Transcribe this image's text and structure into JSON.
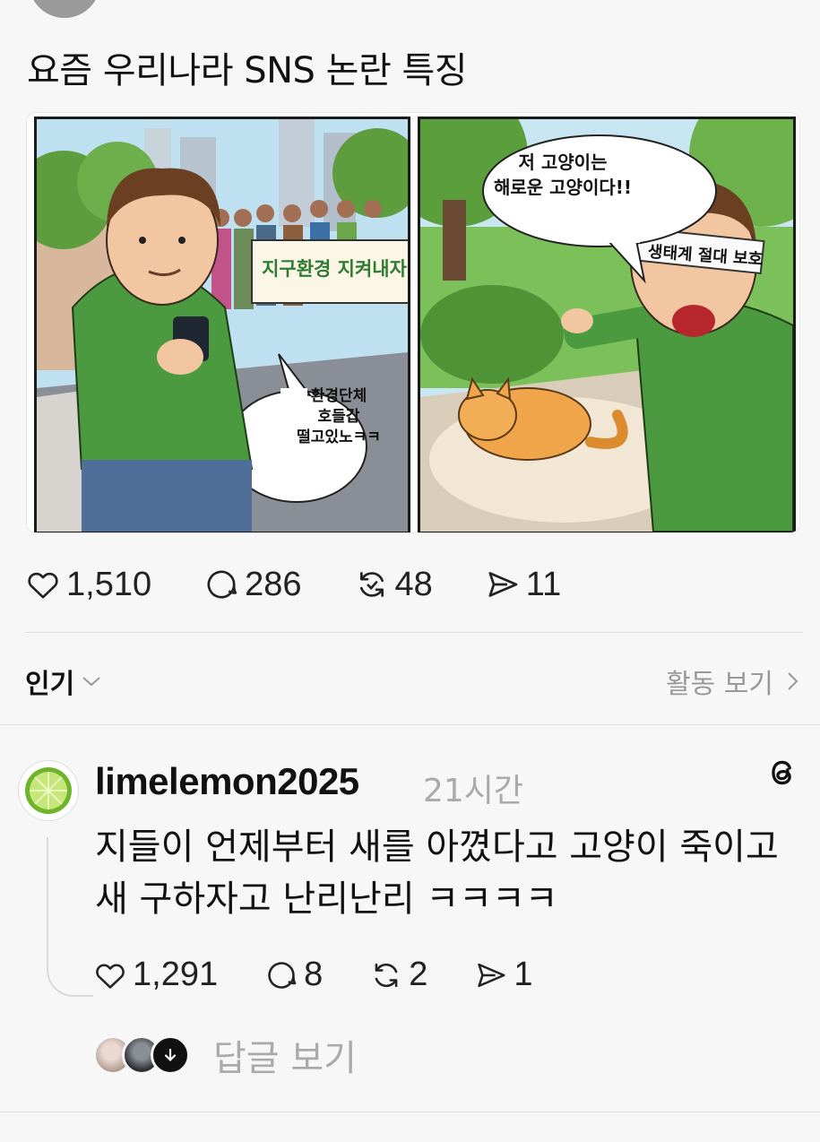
{
  "post": {
    "title": "요즘 우리나라 SNS 논란 특징",
    "comic": {
      "banner": "지구환경 지켜내자",
      "bubble_left": "환경단체\n호들갑\n떨고있노ㅋㅋ",
      "bubble_right": "저 고양이는\n해로운 고양이다!!",
      "headband": "생태계 절대 보호"
    },
    "stats": {
      "likes": "1,510",
      "comments": "286",
      "reposts": "48",
      "shares": "11"
    }
  },
  "sort": {
    "label": "인기",
    "activity_label": "활동 보기"
  },
  "comment": {
    "username": "limelemon2025",
    "time": "21시간",
    "text": "지들이 언제부터 새를 아꼈다고 고양이 죽이고 새 구하자고 난리난리 ㅋㅋㅋㅋ",
    "stats": {
      "likes": "1,291",
      "comments": "8",
      "reposts": "2",
      "shares": "1"
    },
    "view_replies": "답글 보기"
  },
  "icons": [
    "heart-icon",
    "comment-icon",
    "repost-icon",
    "share-icon",
    "chevron-down-icon",
    "chevron-right-icon",
    "threads-icon",
    "arrow-down-icon"
  ]
}
